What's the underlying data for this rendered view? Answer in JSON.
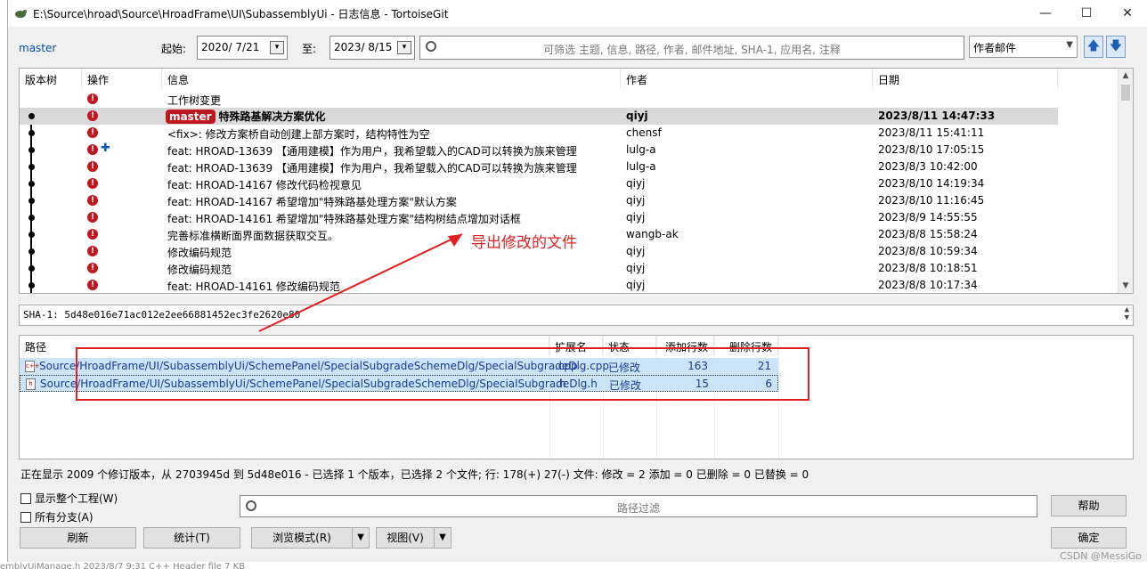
{
  "window": {
    "title": "E:\\Source\\hroad\\Source\\HroadFrame\\UI\\SubassemblyUi - 日志信息 - TortoiseGit",
    "minimize": "—",
    "maximize": "☐",
    "close": "✕"
  },
  "toolbar": {
    "branch": "master",
    "from_label": "起始:",
    "from_date": "2020/  7/21",
    "to_label": "至:",
    "to_date": "2023/  8/15",
    "filter_placeholder": "可筛选 主题, 信息, 路径, 作者, 邮件地址, SHA-1, 应用名, 注释",
    "filter_field": "作者邮件",
    "up_arrow": "🡅",
    "down_arrow": "🡇"
  },
  "log": {
    "headers": [
      "版本树",
      "操作",
      "信息",
      "作者",
      "日期"
    ],
    "rows": [
      {
        "message": "工作树变更",
        "author": "",
        "date": ""
      },
      {
        "badge": "master",
        "message": "特殊路基解决方案优化",
        "author": "qiyj",
        "date": "2023/8/11 14:47:33"
      },
      {
        "message": "<fix>: 修改方案桥自动创建上部方案时，结构特性为空",
        "author": "chensf",
        "date": "2023/8/11 15:41:11"
      },
      {
        "message": "feat: HROAD-13639 【通用建模】作为用户，我希望载入的CAD可以转换为族来管理",
        "author": "lulg-a",
        "date": "2023/8/10 17:05:15"
      },
      {
        "message": "feat: HROAD-13639 【通用建模】作为用户，我希望载入的CAD可以转换为族来管理",
        "author": "lulg-a",
        "date": "2023/8/3 10:42:00"
      },
      {
        "message": "feat: HROAD-14167 修改代码检视意见",
        "author": "qiyj",
        "date": "2023/8/10 14:19:34"
      },
      {
        "message": "feat: HROAD-14167 希望增加\"特殊路基处理方案\"默认方案",
        "author": "qiyj",
        "date": "2023/8/10 11:16:45"
      },
      {
        "message": "feat: HROAD-14161 希望增加\"特殊路基处理方案\"结构树结点增加对话框",
        "author": "qiyj",
        "date": "2023/8/9 14:55:55"
      },
      {
        "message": "完善标准横断面界面数据获取交互。",
        "author": "wangb-ak",
        "date": "2023/8/8 15:58:24"
      },
      {
        "message": "修改编码规范",
        "author": "qiyj",
        "date": "2023/8/8 10:59:34"
      },
      {
        "message": "修改编码规范",
        "author": "qiyj",
        "date": "2023/8/8 10:18:51"
      },
      {
        "message": "feat: HROAD-14161 修改编码规范",
        "author": "qiyj",
        "date": "2023/8/8 10:17:34"
      }
    ]
  },
  "sha": "SHA-1: 5d48e016e71ac012e2ee66881452ec3fe2620e80",
  "files": {
    "headers": [
      "路径",
      "扩展名",
      "状态",
      "添加行数",
      "删除行数"
    ],
    "rows": [
      {
        "icon": "c++",
        "path": "Source/HroadFrame/UI/SubassemblyUi/SchemePanel/SpecialSubgradeSchemeDlg/SpecialSubgradeDlg.cpp",
        "ext": ".cpp",
        "status": "已修改",
        "added": "163",
        "deleted": "21"
      },
      {
        "icon": "h",
        "path": "Source/HroadFrame/UI/SubassemblyUi/SchemePanel/SpecialSubgradeSchemeDlg/SpecialSubgradeDlg.h",
        "ext": ".h",
        "status": "已修改",
        "added": "15",
        "deleted": "6"
      }
    ]
  },
  "annotation": "导出修改的文件",
  "status_text": "正在显示 2009 个修订版本，从 2703945d 到 5d48e016 - 已选择 1 个版本，已选择 2 个文件; 行: 178(+) 27(-) 文件: 修改 = 2 添加 = 0 已删除 = 0 已替换 = 0",
  "options": {
    "show_whole_project": "显示整个工程(W)",
    "all_branches": "所有分支(A)"
  },
  "path_filter_placeholder": "路径过滤",
  "buttons": {
    "refresh": "刷新",
    "statistics": "统计(T)",
    "browse_mode": "浏览模式(R)",
    "view": "视图(V)",
    "help": "帮助",
    "ok": "确定"
  },
  "background": {
    "footer_text": "emblyUiManage.h           2023/8/7  9:31              C++ Header file              7 KB",
    "watermark": "CSDN @MessiGo"
  }
}
